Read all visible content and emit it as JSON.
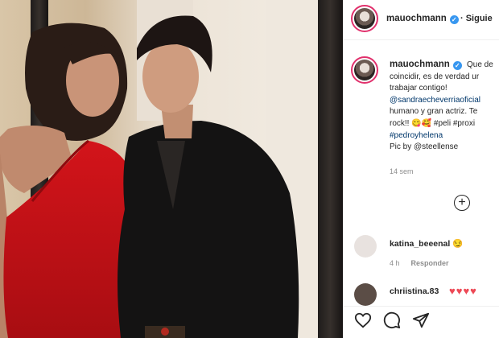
{
  "header": {
    "username": "mauochmann",
    "follow_label": "· Siguie"
  },
  "caption": {
    "username": "mauochmann",
    "lines": [
      "Que de",
      "coincidir, es de verdad ur",
      "trabajar contigo!",
      "@sandraecheverriaoficial",
      "humano y gran actriz. Te",
      "rock!! 😋🥰 #peli #proxi",
      "#pedroyhelena",
      "Pic by @steellense"
    ],
    "time": "14 sem"
  },
  "comments": [
    {
      "username": "katina_beeenal",
      "emoji": "😏",
      "time": "4 h",
      "reply_label": "Responder"
    },
    {
      "username": "chriistina.83",
      "hearts": "♥♥♥♥"
    }
  ],
  "icons": {
    "verified": "verified-badge-icon",
    "more_comments": "plus-circle-icon",
    "like": "heart-outline-icon",
    "comment": "speech-bubble-icon",
    "share": "paper-plane-icon"
  },
  "colors": {
    "verified": "#3897f0",
    "link": "#00376b",
    "heart": "#ed4956",
    "muted": "#8e8e8e"
  }
}
